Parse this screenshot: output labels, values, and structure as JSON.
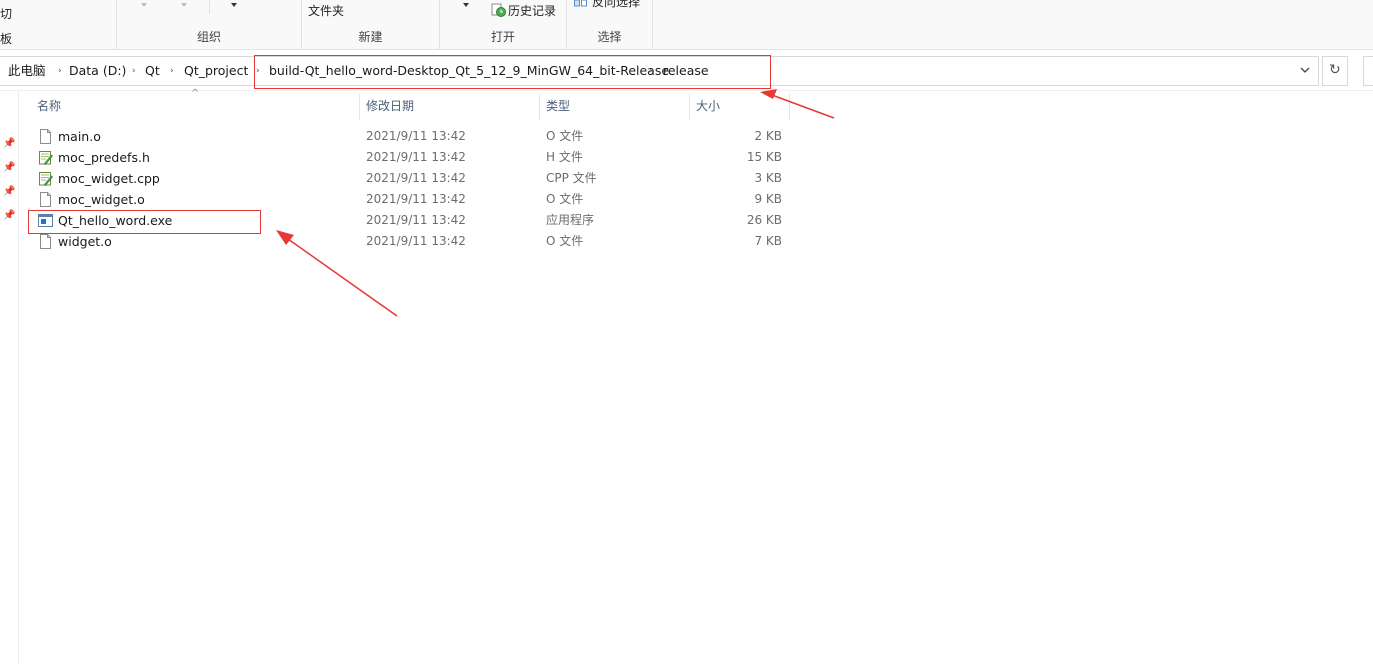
{
  "ribbon": {
    "clipboard_fragment_top": "切",
    "clipboard_fragment_bottom": "板",
    "groups": [
      {
        "label": "组织"
      },
      {
        "label": "新建"
      },
      {
        "label": "打开"
      },
      {
        "label": "选择"
      }
    ],
    "new_folder_label": "文件夹",
    "history_label": "历史记录",
    "invert_selection_label": "反向选择"
  },
  "address": {
    "crumbs": [
      "此电脑",
      "Data (D:)",
      "Qt",
      "Qt_project",
      "build-Qt_hello_word-Desktop_Qt_5_12_9_MinGW_64_bit-Release",
      "release"
    ]
  },
  "columns": {
    "name": "名称",
    "modified": "修改日期",
    "type": "类型",
    "size": "大小"
  },
  "files": [
    {
      "name": "main.o",
      "modified": "2021/9/11 13:42",
      "type": "O 文件",
      "size": "2 KB",
      "icon": "generic-file-icon"
    },
    {
      "name": "moc_predefs.h",
      "modified": "2021/9/11 13:42",
      "type": "H 文件",
      "size": "15 KB",
      "icon": "source-file-icon"
    },
    {
      "name": "moc_widget.cpp",
      "modified": "2021/9/11 13:42",
      "type": "CPP 文件",
      "size": "3 KB",
      "icon": "source-file-icon"
    },
    {
      "name": "moc_widget.o",
      "modified": "2021/9/11 13:42",
      "type": "O 文件",
      "size": "9 KB",
      "icon": "generic-file-icon"
    },
    {
      "name": "Qt_hello_word.exe",
      "modified": "2021/9/11 13:42",
      "type": "应用程序",
      "size": "26 KB",
      "icon": "exe-app-icon"
    },
    {
      "name": "widget.o",
      "modified": "2021/9/11 13:42",
      "type": "O 文件",
      "size": "7 KB",
      "icon": "generic-file-icon"
    }
  ],
  "colors": {
    "annotation_red": "#e53935",
    "header_text": "#4c607a"
  }
}
